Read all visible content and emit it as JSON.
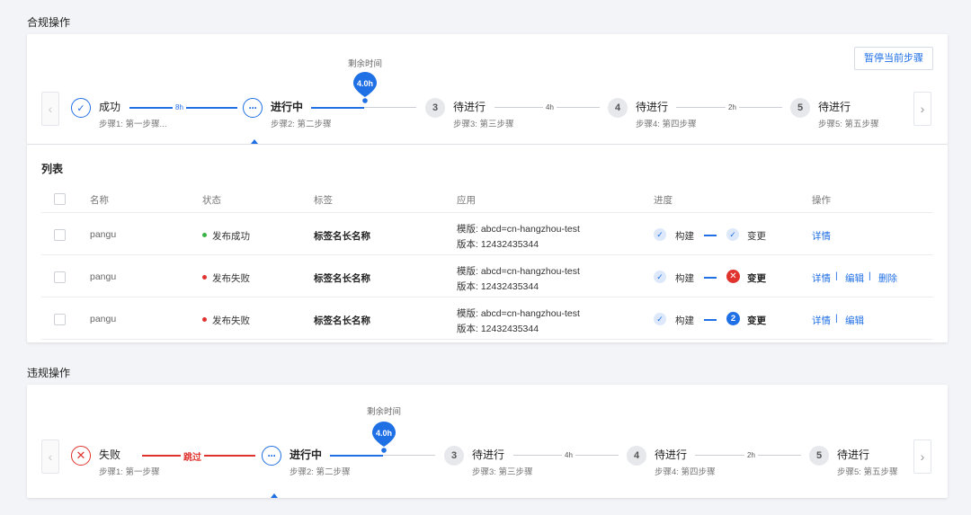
{
  "compliance": {
    "section_title": "合规操作",
    "pause_button": "暂停当前步骤",
    "remaining_label": "剩余时间",
    "remaining_value": "4.0h",
    "steps": [
      {
        "title": "成功",
        "sub": "步骤1: 第一步骤...",
        "status": "success"
      },
      {
        "title": "进行中",
        "sub": "步骤2: 第二步骤",
        "status": "in-progress"
      },
      {
        "title": "待进行",
        "sub": "步骤3: 第三步骤",
        "status": "waiting",
        "number": "3"
      },
      {
        "title": "待进行",
        "sub": "步骤4: 第四步骤",
        "status": "waiting",
        "number": "4"
      },
      {
        "title": "待进行",
        "sub": "步骤5: 第五步骤",
        "status": "waiting",
        "number": "5"
      }
    ],
    "connectors": [
      "8h",
      "",
      "4h",
      "2h"
    ]
  },
  "list": {
    "title": "列表",
    "columns": [
      "名称",
      "状态",
      "标签",
      "应用",
      "进度",
      "操作"
    ],
    "rows": [
      {
        "name": "pangu",
        "status": "发布成功",
        "status_color": "#3bb346",
        "tag": "标签名长名称",
        "app_line1": "模版: abcd=cn-hangzhou-test",
        "app_line2": "版本: 12432435344",
        "progress_step1": "构建",
        "progress_step2": "变更",
        "progress_step2_state": "done",
        "actions": [
          "详情"
        ]
      },
      {
        "name": "pangu",
        "status": "发布失败",
        "status_color": "#e0332e",
        "tag": "标签名长名称",
        "app_line1": "模版: abcd=cn-hangzhou-test",
        "app_line2": "版本: 12432435344",
        "progress_step1": "构建",
        "progress_step2": "变更",
        "progress_step2_state": "failed",
        "actions": [
          "详情",
          "编辑",
          "删除"
        ]
      },
      {
        "name": "pangu",
        "status": "发布失败",
        "status_color": "#e0332e",
        "tag": "标签名长名称",
        "app_line1": "模版: abcd=cn-hangzhou-test",
        "app_line2": "版本: 12432435344",
        "progress_step1": "构建",
        "progress_step2": "变更",
        "progress_step2_state": "current",
        "progress_step2_number": "2",
        "actions": [
          "详情",
          "编辑"
        ]
      }
    ]
  },
  "violation": {
    "section_title": "违规操作",
    "remaining_label": "剩余时间",
    "remaining_value": "4.0h",
    "steps": [
      {
        "title": "失败",
        "sub": "步骤1: 第一步骤",
        "status": "failed"
      },
      {
        "title": "进行中",
        "sub": "步骤2: 第二步骤",
        "status": "in-progress"
      },
      {
        "title": "待进行",
        "sub": "步骤3: 第三步骤",
        "status": "waiting",
        "number": "3"
      },
      {
        "title": "待进行",
        "sub": "步骤4: 第四步骤",
        "status": "waiting",
        "number": "4"
      },
      {
        "title": "待进行",
        "sub": "步骤5: 第五步骤",
        "status": "waiting",
        "number": "5"
      }
    ],
    "connectors": [
      "跳过",
      "",
      "4h",
      "2h"
    ]
  },
  "icons": {
    "success": "check-icon",
    "in_progress": "ellipsis-icon",
    "failed": "close-icon",
    "prev": "chevron-left-icon",
    "next": "chevron-right-icon",
    "pin": "map-pin-icon"
  },
  "colors": {
    "primary": "#1f6fe5",
    "danger": "#e0332e",
    "success": "#3bb346"
  }
}
